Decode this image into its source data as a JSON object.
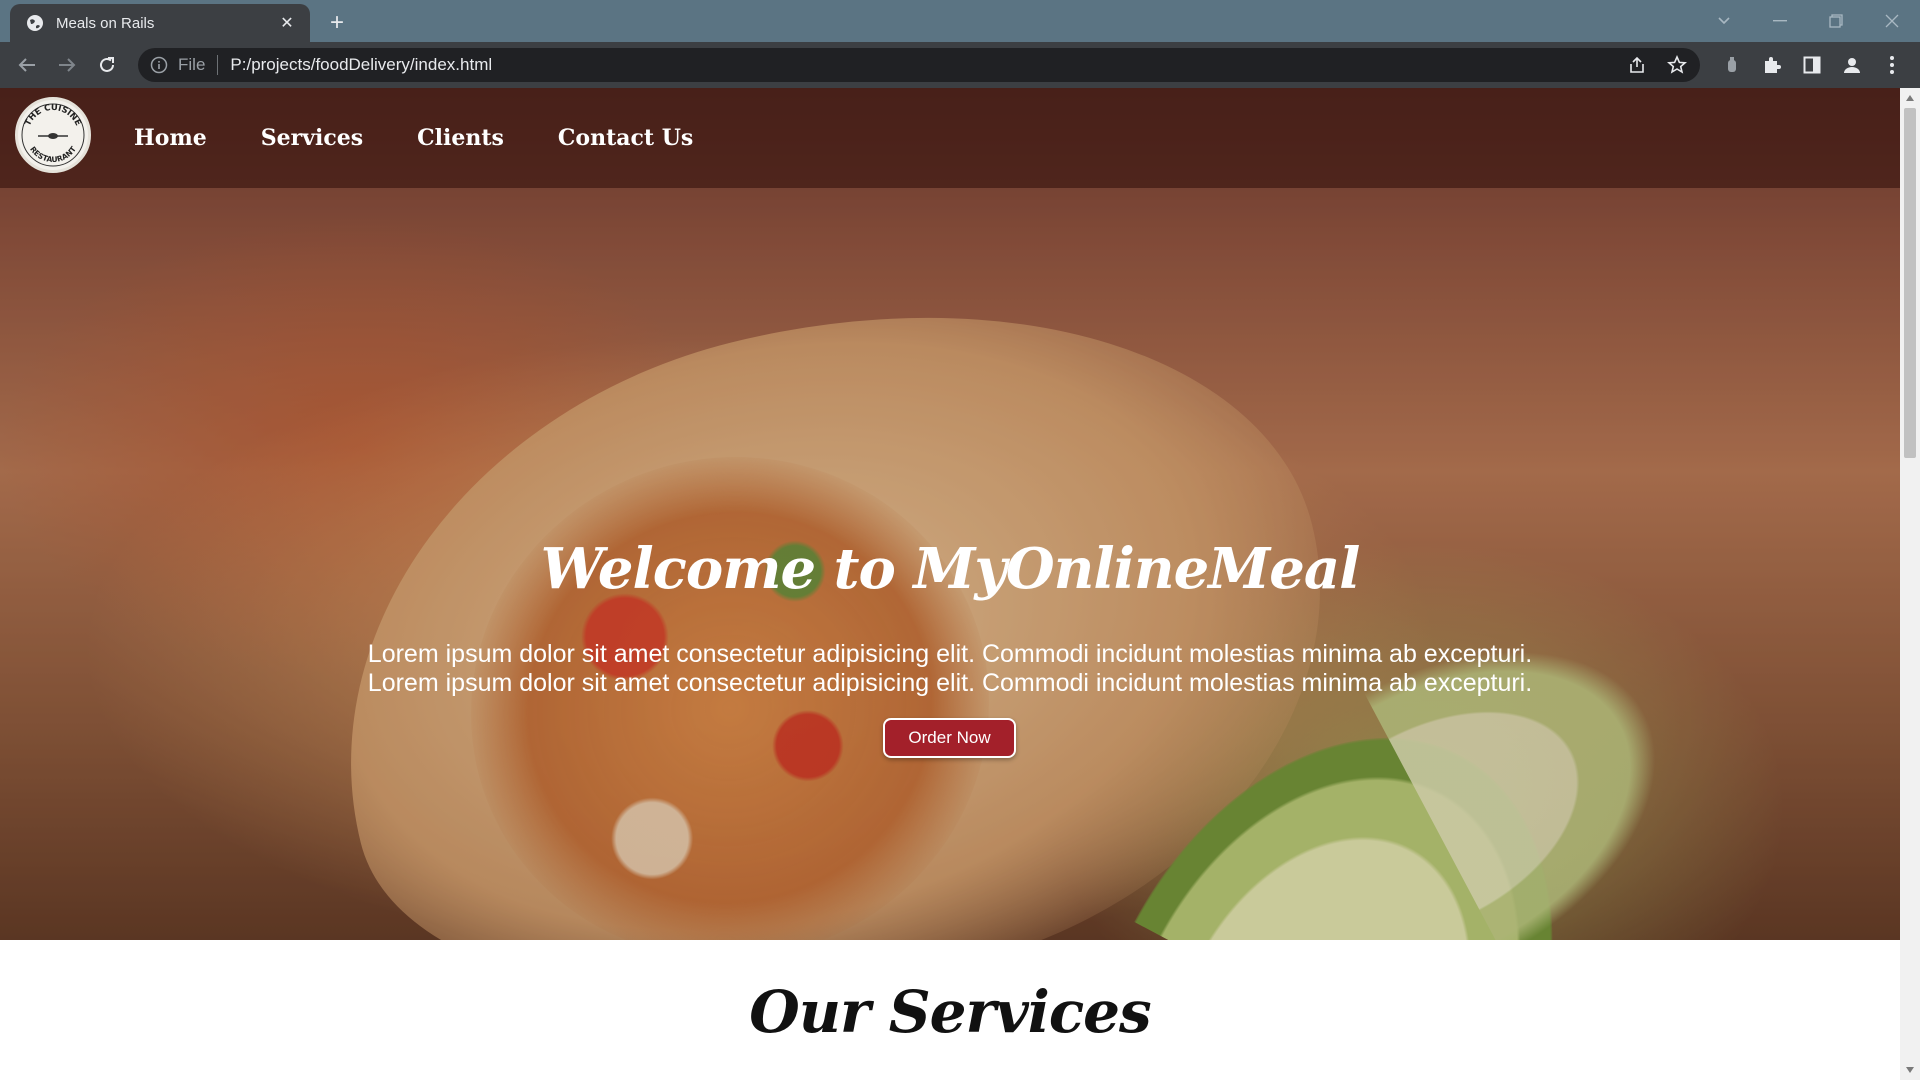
{
  "browser": {
    "tab_title": "Meals on Rails",
    "tab_close": "✕",
    "new_tab": "+",
    "url_scheme": "File",
    "url": "P:/projects/foodDelivery/index.html"
  },
  "site": {
    "logo_text": "THE CUISINE RESTAURANT",
    "nav": [
      "Home",
      "Services",
      "Clients",
      "Contact Us"
    ],
    "hero": {
      "title": "Welcome to MyOnlineMeal",
      "lines": [
        "Lorem ipsum dolor sit amet consectetur adipisicing elit. Commodi incidunt molestias minima ab excepturi.",
        "Lorem ipsum dolor sit amet consectetur adipisicing elit. Commodi incidunt molestias minima ab excepturi."
      ],
      "cta": "Order Now"
    },
    "services_title": "Our Services"
  },
  "colors": {
    "tabbar": "#5b7483",
    "toolbar": "#3c3f43",
    "header_overlay": "rgba(55,20,15,0.62)",
    "cta": "#a3202a"
  }
}
